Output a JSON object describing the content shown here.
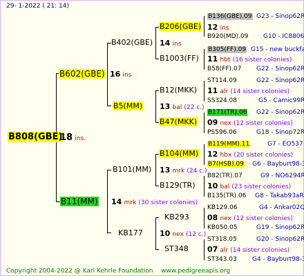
{
  "header": {
    "date": "29-   1-2022 (  21:  14)"
  },
  "footer": {
    "copyright": "Copyright 2004-2022 @ Karl Kehrle Foundation",
    "site": "www.pedigreeapis.org"
  },
  "root": {
    "name": "B808(GBE)",
    "ins_num": "18",
    "ins_txt": "ins."
  },
  "l1_top": {
    "name": "B602(GBE)",
    "ins_num": "16",
    "ins_txt": "ins"
  },
  "l1_bot": {
    "name": "B11(MM)",
    "ins_num": "14",
    "ins_txt": "mrk",
    "sisters": "(30 sister colonies)"
  },
  "l2": {
    "a": {
      "name": "B402(GBE)",
      "ins_num": "14",
      "ins_txt": "ins"
    },
    "b": {
      "name": "B5(MM)",
      "ins_num": "",
      "ins_txt": ""
    },
    "c": {
      "name": "B101(MM)",
      "ins_num": "13",
      "ins_txt": "mrk",
      "sisters": "(24 c.)"
    },
    "d": {
      "name": "KB177"
    }
  },
  "l3": {
    "a": {
      "name": "B206(GBE)",
      "ins_num": "12",
      "ins_txt": "ins"
    },
    "b": {
      "name": "B1003(FF)",
      "ins_num": "11",
      "ins_txt": "hbt",
      "sisters": "(16 sister colonies)"
    },
    "c": {
      "name": "B12(MKK)",
      "ins_num": "11",
      "ins_txt": "alr",
      "sisters": "(14 sister colonies)"
    },
    "d": {
      "name": "B47(MKK)",
      "ins_num": "09",
      "ins_txt": "nex",
      "sisters": "(12 sister colonies)"
    },
    "e": {
      "name": "B104(MM)",
      "ins_num": "12",
      "ins_txt": "hbx",
      "sisters": "(20 sister colonies)"
    },
    "f": {
      "name": "B129(TR)",
      "ins_num": "10",
      "ins_txt": "bal",
      "sisters": "(23 sister colonies)"
    },
    "g": {
      "name": "KB293",
      "ins_num": "08",
      "ins_txt": "nex",
      "sisters": "(12 sister colonies)"
    },
    "h": {
      "name": "ST348",
      "ins_num": "07",
      "ins_txt": "alr",
      "sisters": "(14 sister colonies)"
    }
  },
  "l2b_extra": {
    "ins_num": "13",
    "ins_txt": "bal",
    "sisters": "(22 c.)"
  },
  "l2d_extra": {
    "ins_num": "10",
    "ins_txt": "nex",
    "sisters": "(12 c.)"
  },
  "l4": [
    {
      "name": "B136(GBE).09",
      "note": "G23 - Sinop62R"
    },
    {
      "name": "B920(MD).09",
      "note": "G10 - IC8806"
    },
    {
      "name": "B305(FF).09",
      "note": "G15 - new buckfas"
    },
    {
      "name": "B58(FF).07",
      "note": "G22 - Sinop62R"
    },
    {
      "name": "ST114.09",
      "note": "G22 - Sinop62R"
    },
    {
      "name": "SS324.08",
      "note": "G5 - Camic99R"
    },
    {
      "name": "B171(TR).06",
      "note": "G22 - Sinop62R"
    },
    {
      "name": "PS596.06",
      "note": "G18 - Sinop72R"
    },
    {
      "name": "B119(MM).11",
      "note": "G7 - EO537"
    },
    {
      "name": "B7(HSB).09",
      "note": "G6 - Bayburt98-3"
    },
    {
      "name": "B82(TR).07",
      "note": "G9 - NO6294R"
    },
    {
      "name": "B135(TR).06",
      "note": "G8 - Takab93aR"
    },
    {
      "name": "KB129.06",
      "note": "G4 - Ankar02Q"
    },
    {
      "name": "KB050.05",
      "note": "G19 - Sinop62R"
    },
    {
      "name": "ST318.05",
      "note": "G20 - Sinop62R"
    },
    {
      "name": "ST343.03",
      "note": "G4 - Bayburt98-3"
    }
  ]
}
